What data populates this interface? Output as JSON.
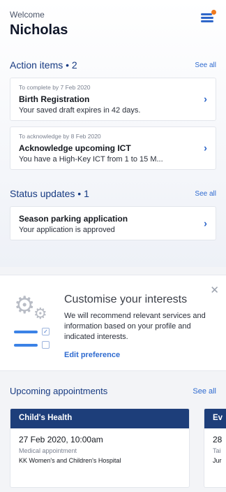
{
  "header": {
    "greeting": "Welcome",
    "name": "Nicholas",
    "menu_icon": "hamburger-menu-icon",
    "notification_dot_color": "#f07a1e"
  },
  "action_items": {
    "title": "Action items • 2",
    "see_all": "See all",
    "items": [
      {
        "subtitle": "To complete by 7 Feb 2020",
        "title": "Birth Registration",
        "body": "Your saved draft expires in 42 days."
      },
      {
        "subtitle": "To acknowledge by 8 Feb 2020",
        "title": "Acknowledge upcoming ICT",
        "body": "You have a High-Key ICT from 1 to 15 M..."
      }
    ]
  },
  "status_updates": {
    "title": "Status updates • 1",
    "see_all": "See all",
    "items": [
      {
        "title": "Season parking application",
        "body": "Your application is approved"
      }
    ]
  },
  "interests": {
    "title": "Customise your interests",
    "text": "We will recommend relevant services and information based on your profile and indicated interests.",
    "link": "Edit preference",
    "close_icon": "close-icon"
  },
  "appointments": {
    "title": "Upcoming appointments",
    "see_all": "See all",
    "items": [
      {
        "band": "Child's Health",
        "date": "27 Feb 2020, 10:00am",
        "type": "Medical appointment",
        "location": "KK Women's and Children's Hospital"
      },
      {
        "band": "Ev",
        "date": "28",
        "type": "Tai",
        "location": "Jur"
      }
    ]
  },
  "colors": {
    "accent": "#2f67c9",
    "band": "#1d3e7a",
    "section_title": "#163a82"
  }
}
